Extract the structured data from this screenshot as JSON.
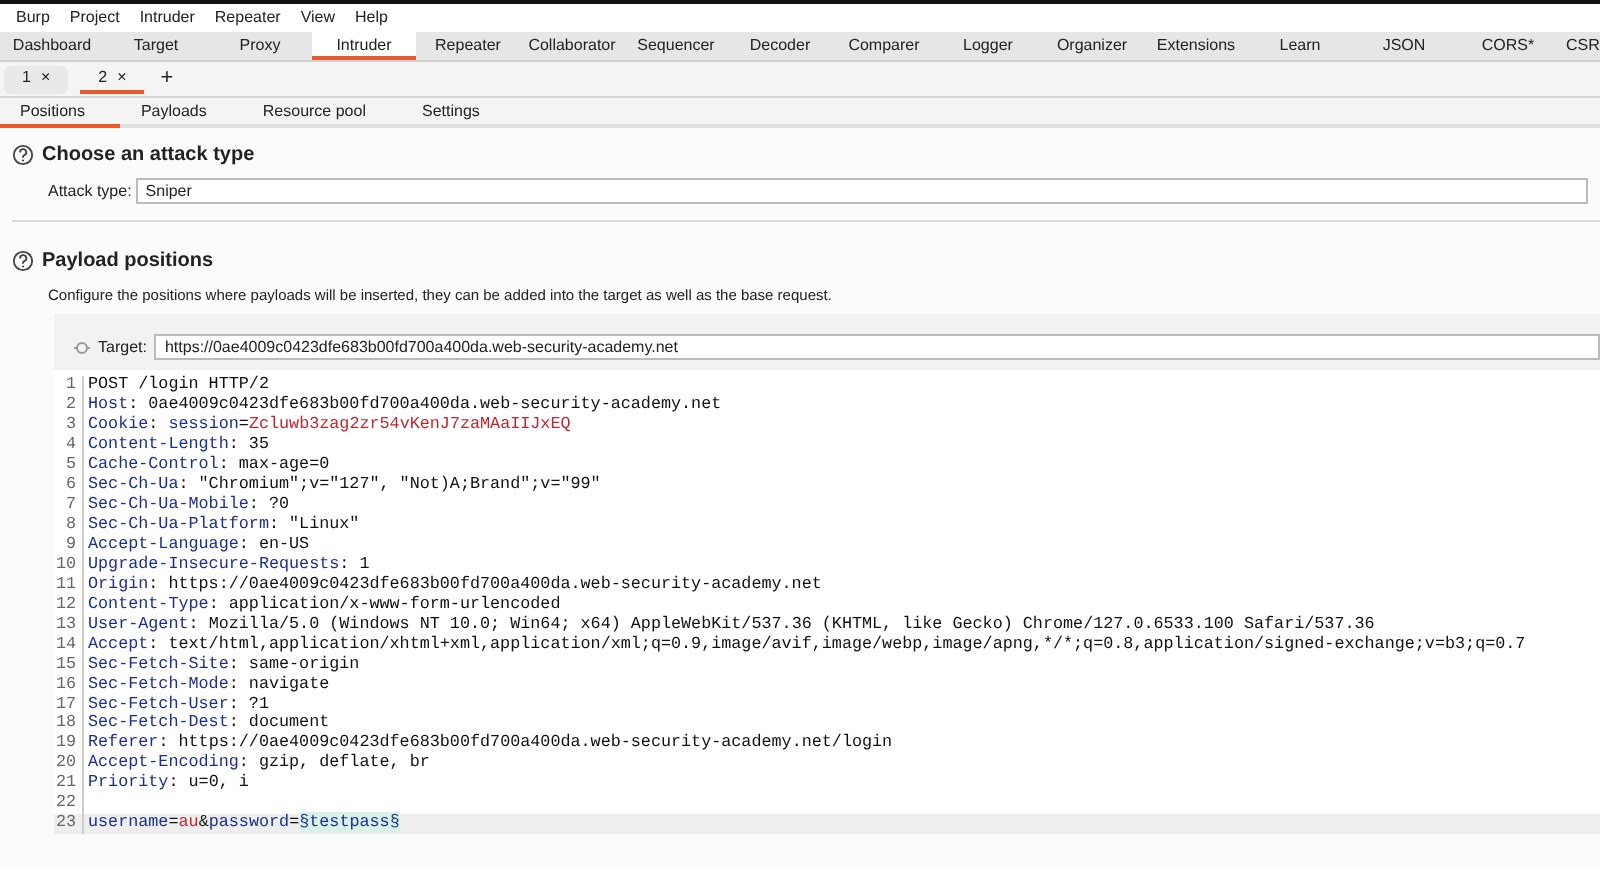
{
  "menu": [
    "Burp",
    "Project",
    "Intruder",
    "Repeater",
    "View",
    "Help"
  ],
  "main_tabs": [
    {
      "label": "Dashboard",
      "selected": false
    },
    {
      "label": "Target",
      "selected": false
    },
    {
      "label": "Proxy",
      "selected": false
    },
    {
      "label": "Intruder",
      "selected": true
    },
    {
      "label": "Repeater",
      "selected": false
    },
    {
      "label": "Collaborator",
      "selected": false
    },
    {
      "label": "Sequencer",
      "selected": false
    },
    {
      "label": "Decoder",
      "selected": false
    },
    {
      "label": "Comparer",
      "selected": false
    },
    {
      "label": "Logger",
      "selected": false
    },
    {
      "label": "Organizer",
      "selected": false
    },
    {
      "label": "Extensions",
      "selected": false
    },
    {
      "label": "Learn",
      "selected": false
    },
    {
      "label": "JSON",
      "selected": false
    },
    {
      "label": "CORS*",
      "selected": false
    },
    {
      "label": "CSR",
      "selected": false
    }
  ],
  "request_tabs": [
    {
      "label": "1",
      "close": "×",
      "selected": false
    },
    {
      "label": "2",
      "close": "×",
      "selected": true
    }
  ],
  "add_tab": "+",
  "sub_tabs": [
    {
      "label": "Positions",
      "selected": true
    },
    {
      "label": "Payloads",
      "selected": false
    },
    {
      "label": "Resource pool",
      "selected": false
    },
    {
      "label": "Settings",
      "selected": false
    }
  ],
  "attack_section": {
    "title": "Choose an attack type",
    "label": "Attack type:",
    "value": "Sniper"
  },
  "payload_section": {
    "title": "Payload positions",
    "description": "Configure the positions where payloads will be inserted, they can be added into the target as well as the base request.",
    "target_label": "Target:",
    "target_value": "https://0ae4009c0423dfe683b00fd700a400da.web-security-academy.net"
  },
  "request_lines": [
    {
      "number": "1",
      "segments": [
        {
          "kind": "plain",
          "text": "POST /login HTTP/2"
        }
      ]
    },
    {
      "number": "2",
      "segments": [
        {
          "kind": "name",
          "text": "Host"
        },
        {
          "kind": "plain",
          "text": ": 0ae4009c0423dfe683b00fd700a400da.web-security-academy.net"
        }
      ]
    },
    {
      "number": "3",
      "segments": [
        {
          "kind": "name",
          "text": "Cookie"
        },
        {
          "kind": "plain",
          "text": ": "
        },
        {
          "kind": "name",
          "text": "session"
        },
        {
          "kind": "plain",
          "text": "="
        },
        {
          "kind": "value",
          "text": "Zcluwb3zag2zr54vKenJ7zaMAaIIJxEQ"
        }
      ]
    },
    {
      "number": "4",
      "segments": [
        {
          "kind": "name",
          "text": "Content-Length"
        },
        {
          "kind": "plain",
          "text": ": 35"
        }
      ]
    },
    {
      "number": "5",
      "segments": [
        {
          "kind": "name",
          "text": "Cache-Control"
        },
        {
          "kind": "plain",
          "text": ": max-age=0"
        }
      ]
    },
    {
      "number": "6",
      "segments": [
        {
          "kind": "name",
          "text": "Sec-Ch-Ua"
        },
        {
          "kind": "plain",
          "text": ": \"Chromium\";v=\"127\", \"Not)A;Brand\";v=\"99\""
        }
      ]
    },
    {
      "number": "7",
      "segments": [
        {
          "kind": "name",
          "text": "Sec-Ch-Ua-Mobile"
        },
        {
          "kind": "plain",
          "text": ": ?0"
        }
      ]
    },
    {
      "number": "8",
      "segments": [
        {
          "kind": "name",
          "text": "Sec-Ch-Ua-Platform"
        },
        {
          "kind": "plain",
          "text": ": \"Linux\""
        }
      ]
    },
    {
      "number": "9",
      "segments": [
        {
          "kind": "name",
          "text": "Accept-Language"
        },
        {
          "kind": "plain",
          "text": ": en-US"
        }
      ]
    },
    {
      "number": "10",
      "segments": [
        {
          "kind": "name",
          "text": "Upgrade-Insecure-Requests"
        },
        {
          "kind": "plain",
          "text": ": 1"
        }
      ]
    },
    {
      "number": "11",
      "segments": [
        {
          "kind": "name",
          "text": "Origin"
        },
        {
          "kind": "plain",
          "text": ": https://0ae4009c0423dfe683b00fd700a400da.web-security-academy.net"
        }
      ]
    },
    {
      "number": "12",
      "segments": [
        {
          "kind": "name",
          "text": "Content-Type"
        },
        {
          "kind": "plain",
          "text": ": application/x-www-form-urlencoded"
        }
      ]
    },
    {
      "number": "13",
      "segments": [
        {
          "kind": "name",
          "text": "User-Agent"
        },
        {
          "kind": "plain",
          "text": ": Mozilla/5.0 (Windows NT 10.0; Win64; x64) AppleWebKit/537.36 (KHTML, like Gecko) Chrome/127.0.6533.100 Safari/537.36"
        }
      ]
    },
    {
      "number": "14",
      "segments": [
        {
          "kind": "name",
          "text": "Accept"
        },
        {
          "kind": "plain",
          "text": ": text/html,application/xhtml+xml,application/xml;q=0.9,image/avif,image/webp,image/apng,*/*;q=0.8,application/signed-exchange;v=b3;q=0.7"
        }
      ]
    },
    {
      "number": "15",
      "segments": [
        {
          "kind": "name",
          "text": "Sec-Fetch-Site"
        },
        {
          "kind": "plain",
          "text": ": same-origin"
        }
      ]
    },
    {
      "number": "16",
      "segments": [
        {
          "kind": "name",
          "text": "Sec-Fetch-Mode"
        },
        {
          "kind": "plain",
          "text": ": navigate"
        }
      ]
    },
    {
      "number": "17",
      "segments": [
        {
          "kind": "name",
          "text": "Sec-Fetch-User"
        },
        {
          "kind": "plain",
          "text": ": ?1"
        }
      ]
    },
    {
      "number": "18",
      "segments": [
        {
          "kind": "name",
          "text": "Sec-Fetch-Dest"
        },
        {
          "kind": "plain",
          "text": ": document"
        }
      ]
    },
    {
      "number": "19",
      "segments": [
        {
          "kind": "name",
          "text": "Referer"
        },
        {
          "kind": "plain",
          "text": ": https://0ae4009c0423dfe683b00fd700a400da.web-security-academy.net/login"
        }
      ]
    },
    {
      "number": "20",
      "segments": [
        {
          "kind": "name",
          "text": "Accept-Encoding"
        },
        {
          "kind": "plain",
          "text": ": gzip, deflate, br"
        }
      ]
    },
    {
      "number": "21",
      "segments": [
        {
          "kind": "name",
          "text": "Priority"
        },
        {
          "kind": "plain",
          "text": ": u=0, i"
        }
      ]
    },
    {
      "number": "22"
    },
    {
      "number": "23",
      "selected": true,
      "segments": [
        {
          "kind": "name",
          "text": "username"
        },
        {
          "kind": "plain",
          "text": "="
        },
        {
          "kind": "value",
          "text": "au"
        },
        {
          "kind": "plain",
          "text": "&"
        },
        {
          "kind": "name",
          "text": "password"
        },
        {
          "kind": "plain",
          "text": "="
        },
        {
          "kind": "marker",
          "text": "§testpass§"
        }
      ]
    }
  ]
}
